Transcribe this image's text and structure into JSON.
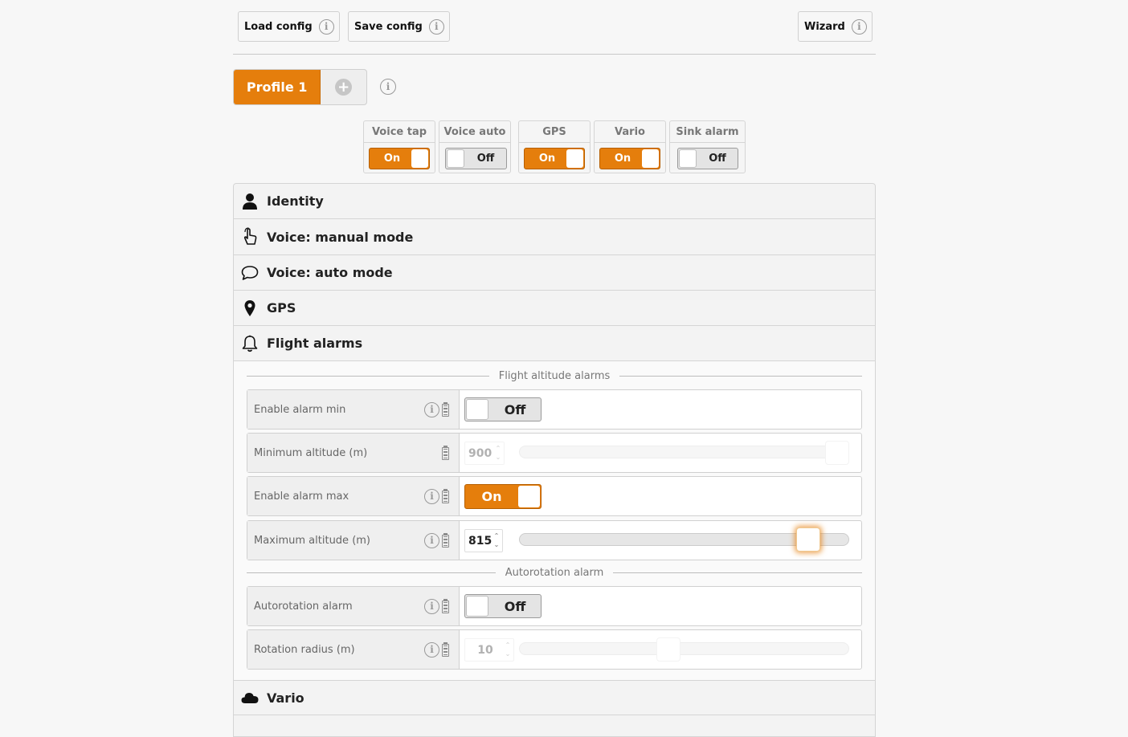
{
  "toolbar": {
    "load_label": "Load config",
    "save_label": "Save config",
    "wizard_label": "Wizard"
  },
  "profile": {
    "active_tab": "Profile 1"
  },
  "quick_toggles": [
    {
      "label": "Voice tap",
      "state": "On"
    },
    {
      "label": "Voice auto",
      "state": "Off"
    },
    {
      "label": "GPS",
      "state": "On"
    },
    {
      "label": "Vario",
      "state": "On"
    },
    {
      "label": "Sink alarm",
      "state": "Off"
    }
  ],
  "sections": [
    {
      "label": "Identity",
      "icon": "user-icon"
    },
    {
      "label": "Voice: manual mode",
      "icon": "tap-hand-icon"
    },
    {
      "label": "Voice: auto mode",
      "icon": "speech-bubble-icon"
    },
    {
      "label": "GPS",
      "icon": "map-pin-icon"
    },
    {
      "label": "Flight alarms",
      "icon": "bell-icon"
    }
  ],
  "flight_alarms": {
    "group1_title": "Flight altitude alarms",
    "group2_title": "Autorotation alarm",
    "rows": {
      "enable_min": {
        "label": "Enable alarm min",
        "state": "Off"
      },
      "min_alt": {
        "label": "Minimum altitude (m)",
        "value": "900",
        "fraction": 1.0
      },
      "enable_max": {
        "label": "Enable alarm max",
        "state": "On"
      },
      "max_alt": {
        "label": "Maximum altitude (m)",
        "value": "815",
        "fraction": 0.905
      },
      "autorot": {
        "label": "Autorotation alarm",
        "state": "Off"
      },
      "radius": {
        "label": "Rotation radius (m)",
        "value": "10",
        "fraction": 0.45
      }
    }
  },
  "vario_section": {
    "label": "Vario",
    "icon": "cloud-icon"
  },
  "colors": {
    "accent": "#e57e0c",
    "background": "#f7f7f7"
  }
}
